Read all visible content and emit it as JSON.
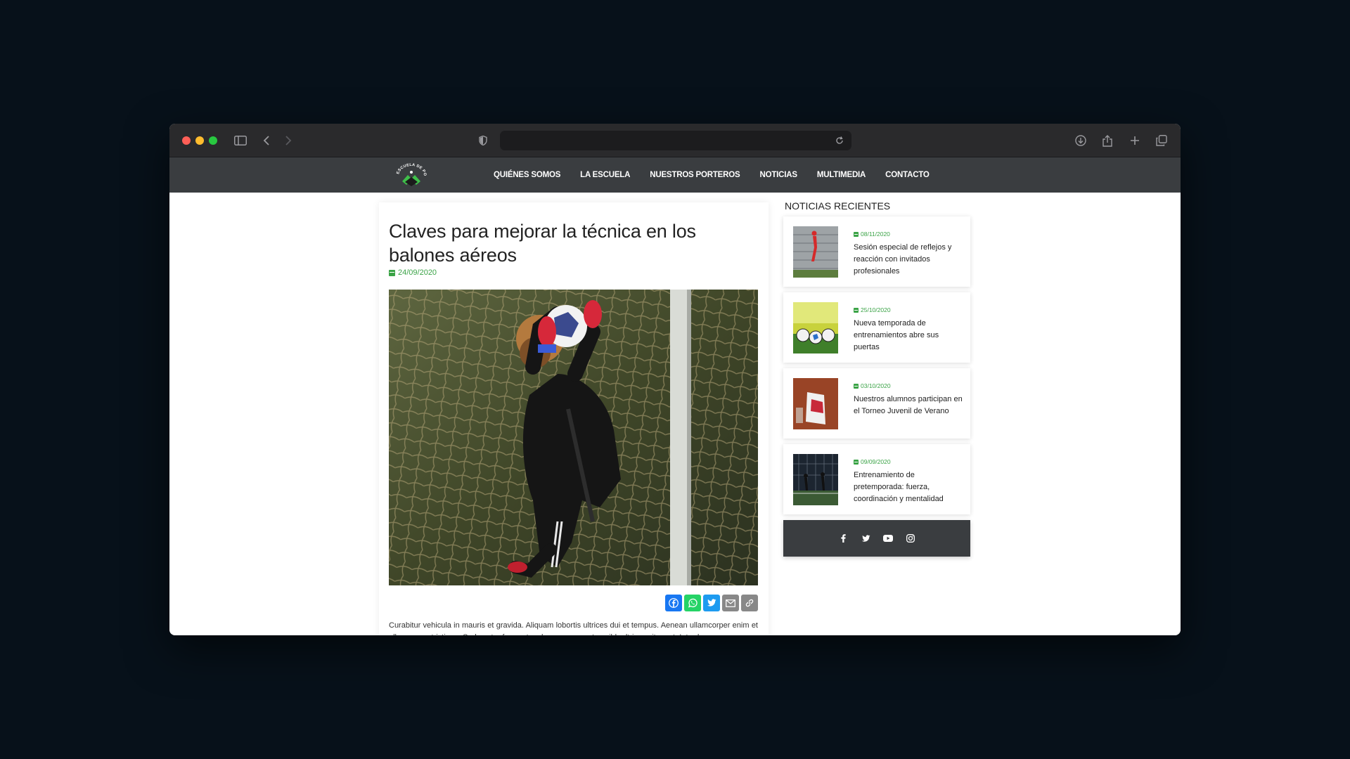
{
  "nav": {
    "logo_text": "ESCUELA DE PORTEROS",
    "items": [
      {
        "label": "QUIÉNES SOMOS"
      },
      {
        "label": "LA ESCUELA"
      },
      {
        "label": "NUESTROS PORTEROS"
      },
      {
        "label": "NOTICIAS"
      },
      {
        "label": "MULTIMEDIA"
      },
      {
        "label": "CONTACTO"
      }
    ]
  },
  "article": {
    "title": "Claves para mejorar la técnica en los balones aéreos",
    "date": "24/09/2020",
    "body": "Curabitur vehicula in mauris et gravida. Aliquam lobortis ultrices dui et tempus. Aenean ullamcorper enim et ullamcorper tristique. Sed auctor fermentum lorem, ac egestas nibh ultrices sit amet. Interdum"
  },
  "share_buttons": [
    "facebook-icon",
    "whatsapp-icon",
    "twitter-icon",
    "email-icon",
    "copy-link-icon"
  ],
  "sidebar": {
    "heading": "NOTICIAS RECIENTES",
    "news": [
      {
        "date": "08/11/2020",
        "title": "Sesión especial de reflejos y reacción con invitados profesionales"
      },
      {
        "date": "25/10/2020",
        "title": "Nueva temporada de entrenamientos abre sus puertas"
      },
      {
        "date": "03/10/2020",
        "title": "Nuestros alumnos participan en el Torneo Juvenil de Verano"
      },
      {
        "date": "09/09/2020",
        "title": "Entrenamiento de pretemporada: fuerza, coordinación y mentalidad"
      }
    ],
    "social": [
      "facebook-icon",
      "twitter-icon",
      "youtube-icon",
      "instagram-icon"
    ]
  },
  "colors": {
    "accent_green": "#3aa346",
    "nav_bg": "#3a3d40",
    "page_bg": "#07111a"
  }
}
